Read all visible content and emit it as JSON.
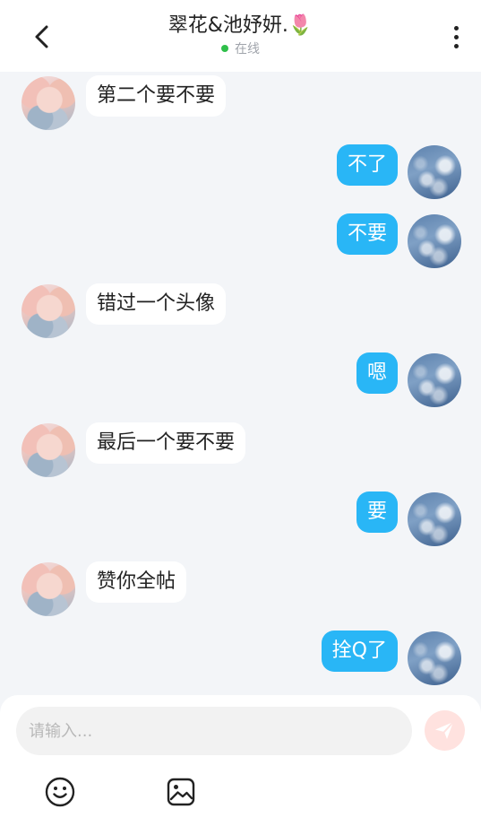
{
  "header": {
    "title": "翠花&池妤妍.🌷",
    "status": "在线",
    "back_icon": "chevron-left-icon",
    "more_icon": "more-vertical-icon"
  },
  "messages": [
    {
      "side": "left",
      "text": "第二个要不要"
    },
    {
      "side": "right",
      "text": "不了"
    },
    {
      "side": "right",
      "text": "不要"
    },
    {
      "side": "left",
      "text": "错过一个头像"
    },
    {
      "side": "right",
      "text": "嗯"
    },
    {
      "side": "left",
      "text": "最后一个要不要"
    },
    {
      "side": "right",
      "text": "要"
    },
    {
      "side": "left",
      "text": "赞你全帖"
    },
    {
      "side": "right",
      "text": "拴Q了"
    }
  ],
  "composer": {
    "placeholder": "请输入...",
    "value": "",
    "send_icon": "send-icon",
    "emoji_icon": "emoji-icon",
    "image_icon": "image-icon"
  },
  "colors": {
    "accent_bubble": "#29b6f6",
    "status_online": "#2fbf4a",
    "background": "#f3f5f8"
  }
}
